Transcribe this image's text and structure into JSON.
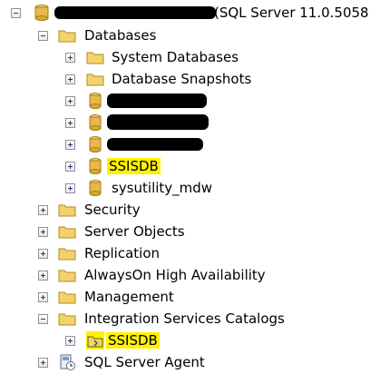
{
  "root": {
    "label": "(SQL Server 11.0.5058 -"
  },
  "databases": {
    "label": "Databases",
    "items": [
      {
        "label": "System Databases"
      },
      {
        "label": "Database Snapshots"
      },
      {
        "label": "SSISDB"
      },
      {
        "label": "sysutility_mdw"
      }
    ]
  },
  "nodes": [
    {
      "label": "Security"
    },
    {
      "label": "Server Objects"
    },
    {
      "label": "Replication"
    },
    {
      "label": "AlwaysOn High Availability"
    },
    {
      "label": "Management"
    },
    {
      "label": "Integration Services Catalogs"
    }
  ],
  "catalog": {
    "label": "SSISDB"
  },
  "agent": {
    "label": "SQL Server Agent"
  },
  "colors": {
    "highlight": "#fff200",
    "folder": "#f2d36b",
    "database": "#d9a82b"
  }
}
